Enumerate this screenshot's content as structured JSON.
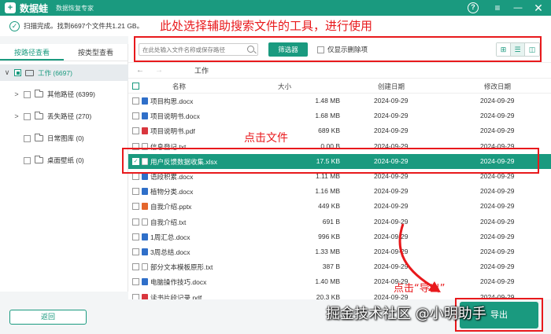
{
  "app": {
    "logo": "+",
    "name": "数据蛙",
    "subtitle": "数据恢复专家",
    "help": "?",
    "menu": "≡",
    "minimize": "—",
    "close": "✕"
  },
  "scan": {
    "status": "扫描完成。找到6697个文件共1.21 GB。"
  },
  "annotations": {
    "top": "此处选择辅助搜索文件的工具，进行使用",
    "click_file": "点击文件",
    "export": "点击“导出”"
  },
  "sidebar": {
    "tabs": [
      "按路径查看",
      "按类型查看"
    ],
    "root": "工作 (6697)",
    "items": [
      "其他路径 (6399)",
      "丢失路径 (270)",
      "日常图库 (0)",
      "桌面壁纸 (0)"
    ],
    "back": "返回"
  },
  "toolbar": {
    "search_placeholder": "在此处输入文件名称或保存路径",
    "filter": "筛选器",
    "deleted_only": "仅显示删除项",
    "view_icons": [
      "⊞",
      "☰",
      "◫"
    ]
  },
  "path": {
    "back_arrow": "←",
    "forward_arrow": "→",
    "current": "工作"
  },
  "table": {
    "headers": {
      "name": "名称",
      "size": "大小",
      "created": "创建日期",
      "modified": "修改日期"
    },
    "rows": [
      {
        "name": "项目构思.docx",
        "size": "1.48 MB",
        "created": "2024-09-29",
        "modified": "2024-09-29",
        "type": "docx"
      },
      {
        "name": "项目说明书.docx",
        "size": "1.68 MB",
        "created": "2024-09-29",
        "modified": "2024-09-29",
        "type": "docx"
      },
      {
        "name": "项目说明书.pdf",
        "size": "689 KB",
        "created": "2024-09-29",
        "modified": "2024-09-29",
        "type": "pdf"
      },
      {
        "name": "信息登记.txt",
        "size": "0.00 B",
        "created": "2024-09-29",
        "modified": "2024-09-29",
        "type": "txt"
      },
      {
        "name": "用户反馈数据收集.xlsx",
        "size": "17.5 KB",
        "created": "2024-09-29",
        "modified": "2024-09-29",
        "type": "xlsx",
        "selected": true
      },
      {
        "name": "语段积累.docx",
        "size": "1.11 MB",
        "created": "2024-09-29",
        "modified": "2024-09-29",
        "type": "docx"
      },
      {
        "name": "植物分类.docx",
        "size": "1.16 MB",
        "created": "2024-09-29",
        "modified": "2024-09-29",
        "type": "docx"
      },
      {
        "name": "自我介绍.pptx",
        "size": "449 KB",
        "created": "2024-09-29",
        "modified": "2024-09-29",
        "type": "pptx"
      },
      {
        "name": "自我介绍.txt",
        "size": "691 B",
        "created": "2024-09-29",
        "modified": "2024-09-29",
        "type": "txt"
      },
      {
        "name": "1周汇总.docx",
        "size": "996 KB",
        "created": "2024-09-29",
        "modified": "2024-09-29",
        "type": "docx"
      },
      {
        "name": "3周总结.docx",
        "size": "1.33 MB",
        "created": "2024-09-29",
        "modified": "2024-09-29",
        "type": "docx"
      },
      {
        "name": "部分文本模板原形.txt",
        "size": "387 B",
        "created": "2024-09-29",
        "modified": "2024-09-29",
        "type": "generic"
      },
      {
        "name": "电脑操作技巧.docx",
        "size": "1.40 MB",
        "created": "2024-09-29",
        "modified": "2024-09-29",
        "type": "docx"
      },
      {
        "name": "读书片段记录.pdf",
        "size": "20.3 KB",
        "created": "2024-09-29",
        "modified": "2024-09-29",
        "type": "pdf"
      }
    ]
  },
  "export": {
    "label": "导出"
  },
  "watermark": "掘金技术社区 @小明助手",
  "colors": {
    "accent": "#1a9a7f",
    "annotation": "#e8191c"
  }
}
